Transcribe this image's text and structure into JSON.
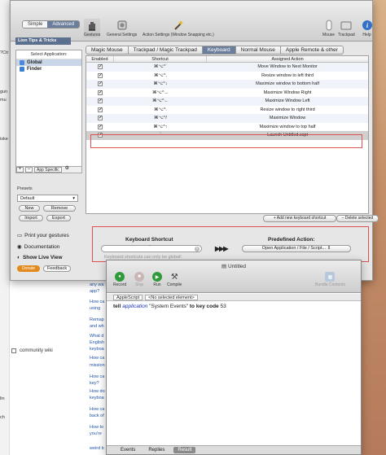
{
  "background": {
    "snippets": [
      "?Ctr",
      "gun",
      "mu",
      "iske"
    ],
    "links": [
      "any wa",
      "app?",
      "How ca",
      "using",
      "Remap",
      "and wh",
      "What d",
      "English",
      "keyboa",
      "How ca",
      "mission",
      "How ca",
      "key?",
      "How do",
      "keyboa",
      "How ca",
      "back of",
      "How to",
      "you're",
      "weird b"
    ],
    "community_wiki": "community wiki",
    "side_letters": [
      "lin",
      "ch"
    ]
  },
  "window": {
    "mode": {
      "simple": "Simple",
      "advanced": "Advanced"
    },
    "toolbar": [
      {
        "label": "Gestures",
        "icon": "hand-icon"
      },
      {
        "label": "General Settings",
        "icon": "settings-icon"
      },
      {
        "label": "Action Settings (Window Snapping etc.)",
        "icon": "wand-icon"
      },
      {
        "label": "Mouse",
        "icon": "mouse-icon"
      },
      {
        "label": "Trackpad",
        "icon": "trackpad-icon"
      },
      {
        "label": "Help",
        "icon": "info-icon"
      }
    ],
    "tips": "Lion Tips & Tricks",
    "select_app_label": "Select Application:",
    "apps": [
      "Global",
      "Finder"
    ],
    "app_specific": "App Specific",
    "presets_label": "Presets",
    "preset_value": "Default",
    "preset_buttons": {
      "new": "New",
      "remove": "Remove",
      "import": "Import",
      "export": "Export"
    },
    "print_gestures": "Print your gestures",
    "documentation": "Documentation",
    "live_view": "Show Live View",
    "donate": "Donate",
    "feedback": "Feedback",
    "tabs": [
      "Magic Mouse",
      "Trackpad / Magic Trackpad",
      "Keyboard",
      "Normal Mouse",
      "Apple Remote & other"
    ],
    "active_tab": "Keyboard",
    "table": {
      "headers": [
        "Enabled",
        "Shortcut",
        "Assigned Action"
      ],
      "rows": [
        {
          "enabled": "✓",
          "shortcut": "⌘⌥^`",
          "action": "Move Window to Next Monitor"
        },
        {
          "enabled": "✓",
          "shortcut": "⌘⌥^,",
          "action": "Resize window to left third"
        },
        {
          "enabled": "✓",
          "shortcut": "⌘⌥^↓",
          "action": "Maximize window to bottom half"
        },
        {
          "enabled": "✓",
          "shortcut": "⌘⌥^→",
          "action": "Maximize Window Right"
        },
        {
          "enabled": "✓",
          "shortcut": "⌘⌥^←",
          "action": "Maximize Window Left"
        },
        {
          "enabled": "✓",
          "shortcut": "⌘⌥^.",
          "action": "Resize window to right third"
        },
        {
          "enabled": "✓",
          "shortcut": "⌘⌥^/",
          "action": "Maximize Window"
        },
        {
          "enabled": "✓",
          "shortcut": "⌘⌥^↑",
          "action": "Maximize window to top half"
        },
        {
          "enabled": "✓",
          "shortcut": "`",
          "action": "Launch Untitled.scpt"
        }
      ]
    },
    "add_shortcut": "+ Add new keyboard shortcut",
    "delete_selected": "– Delete selected",
    "keyboard_shortcut_label": "Keyboard Shortcut",
    "shortcut_value": "`",
    "shortcut_hint": "Keyboard shortcuts can only be global!",
    "arrows": "▶▶▶",
    "predefined_label": "Predefined Action:",
    "predefined_value": "Open Application / File / Script..."
  },
  "editor": {
    "title": "Untitled",
    "tools": [
      "Record",
      "Stop",
      "Run",
      "Compile"
    ],
    "bundle": "Bundle Contents",
    "language": "AppleScript",
    "element": "<No selected element>",
    "code": {
      "kw1": "tell",
      "app": "application",
      "str": "\"System Events\"",
      "kw2": "to",
      "kw3": "key code",
      "num": "53"
    },
    "footer": [
      "Events",
      "Replies",
      "Result"
    ],
    "active_footer": "Result"
  }
}
